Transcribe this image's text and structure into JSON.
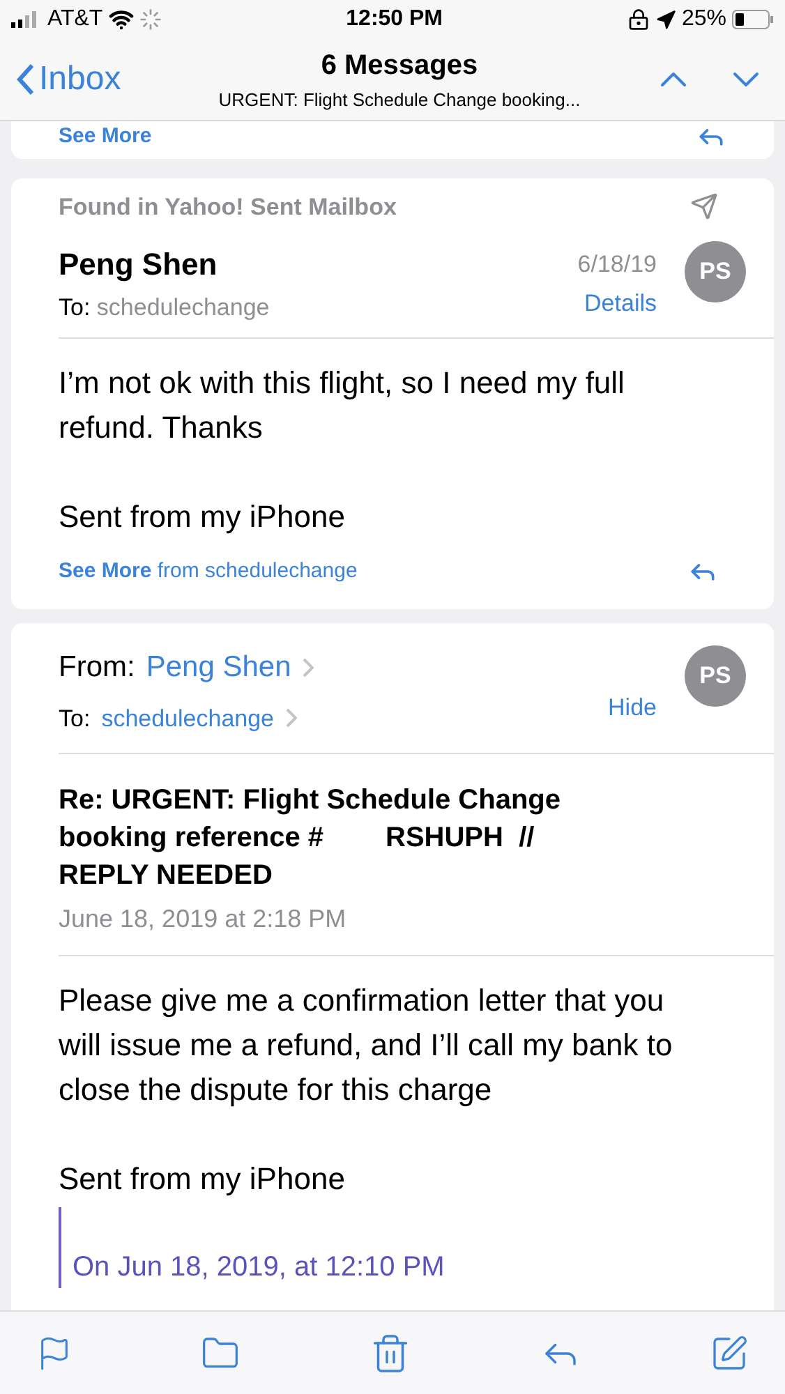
{
  "status_bar": {
    "carrier": "AT&T",
    "time": "12:50 PM",
    "battery": "25%"
  },
  "nav": {
    "back": "Inbox",
    "title": "6 Messages",
    "subtitle": "URGENT: Flight Schedule Change booking..."
  },
  "messages": [
    {
      "kind": "partial",
      "see_more": "See More"
    },
    {
      "kind": "collapsed",
      "found_in": "Found in Yahoo! Sent Mailbox",
      "sender": "Peng Shen",
      "to_label": "To:",
      "to": "schedulechange",
      "date": "6/18/19",
      "details": "Details",
      "avatar": "PS",
      "body": [
        "I’m not ok with this flight, so I need my full refund. Thanks",
        "Sent from my iPhone"
      ],
      "see_more": "See More",
      "see_more_from": "from schedulechange"
    },
    {
      "kind": "expanded",
      "from_label": "From:",
      "sender": "Peng Shen",
      "to_label": "To:",
      "to": "schedulechange",
      "hide": "Hide",
      "avatar": "PS",
      "subject": "Re: URGENT: Flight Schedule Change booking reference #        RSHUPH  // REPLY NEEDED",
      "date": "June 18, 2019 at 2:18 PM",
      "body": [
        "Please give me a confirmation letter that you will issue me a refund,  and I’ll call my bank to close the dispute for this charge",
        "Sent from my iPhone"
      ],
      "quote": "On Jun 18, 2019, at 12:10 PM"
    }
  ]
}
